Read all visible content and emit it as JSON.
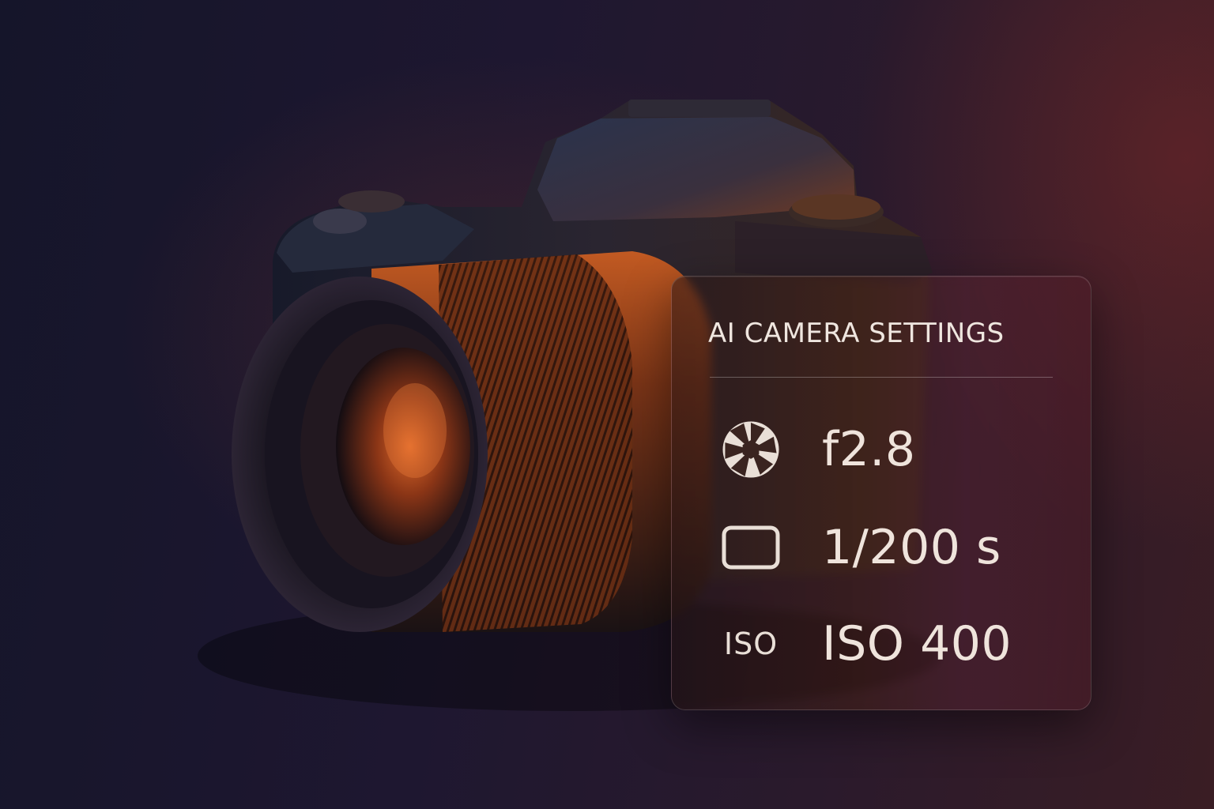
{
  "panel": {
    "title": "AI CAMERA SETTINGS",
    "settings": [
      {
        "icon": "aperture-icon",
        "value": "f2.8"
      },
      {
        "icon": "shutter-icon",
        "value": "1/200 s"
      },
      {
        "icon": "iso-icon",
        "icon_text": "ISO",
        "value": "ISO 400"
      }
    ]
  },
  "colors": {
    "text": "#efe4dc",
    "lens_glow": "#c5581f",
    "camera_body": "#1c1c26"
  }
}
